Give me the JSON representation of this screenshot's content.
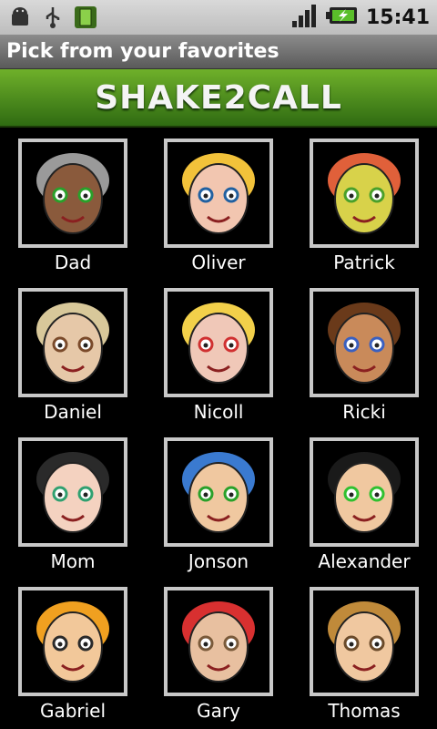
{
  "status_bar": {
    "time": "15:41",
    "icons": [
      "android-icon",
      "usb-icon",
      "battery-widget-icon",
      "signal-icon",
      "battery-charging-icon"
    ]
  },
  "title_bar": {
    "title": "Pick from your favorites"
  },
  "banner": {
    "logo_text": "SHAKE2CALL"
  },
  "contacts": [
    {
      "name": "Dad",
      "avatar": "avatar-dad-icon",
      "skin": "#8a5a3c",
      "hair": "#9a9a9a",
      "accent": "#2aa02a"
    },
    {
      "name": "Oliver",
      "avatar": "avatar-oliver-icon",
      "skin": "#f2c6b0",
      "hair": "#f2c23a",
      "accent": "#2060a0"
    },
    {
      "name": "Patrick",
      "avatar": "avatar-patrick-icon",
      "skin": "#d8d24a",
      "hair": "#e0603a",
      "accent": "#4aa02a"
    },
    {
      "name": "Daniel",
      "avatar": "avatar-daniel-icon",
      "skin": "#e6c8a8",
      "hair": "#d8c89a",
      "accent": "#7a4a2a"
    },
    {
      "name": "Nicoll",
      "avatar": "avatar-nicoll-icon",
      "skin": "#f0c8b8",
      "hair": "#f2d04a",
      "accent": "#d03030"
    },
    {
      "name": "Ricki",
      "avatar": "avatar-ricki-icon",
      "skin": "#c98a5a",
      "hair": "#6a3a1a",
      "accent": "#3a60c0"
    },
    {
      "name": "Mom",
      "avatar": "avatar-mom-icon",
      "skin": "#f4d2c0",
      "hair": "#2a2a2a",
      "accent": "#30a070"
    },
    {
      "name": "Jonson",
      "avatar": "avatar-jonson-icon",
      "skin": "#f0c8a0",
      "hair": "#3a7ad0",
      "accent": "#2aa02a"
    },
    {
      "name": "Alexander",
      "avatar": "avatar-alexander-icon",
      "skin": "#f0c8a0",
      "hair": "#1a1a1a",
      "accent": "#30c030"
    },
    {
      "name": "Gabriel",
      "avatar": "avatar-gabriel-icon",
      "skin": "#f2c89a",
      "hair": "#f0a020",
      "accent": "#2a2a2a"
    },
    {
      "name": "Gary",
      "avatar": "avatar-gary-icon",
      "skin": "#e8c0a0",
      "hair": "#d83030",
      "accent": "#7a5a3a"
    },
    {
      "name": "Thomas",
      "avatar": "avatar-thomas-icon",
      "skin": "#f0c8a0",
      "hair": "#c08a3a",
      "accent": "#6a4a2a"
    }
  ]
}
